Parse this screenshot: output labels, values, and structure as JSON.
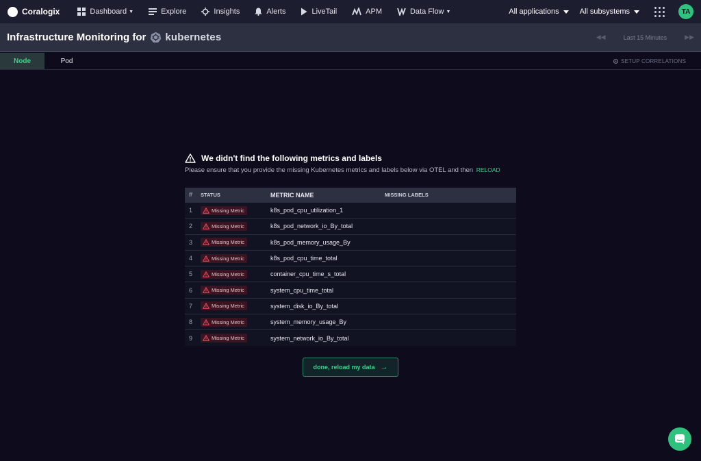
{
  "topnav": {
    "brand": "Coralogix",
    "items": [
      {
        "label": "Dashboard",
        "icon": "dashboard-icon",
        "caret": true
      },
      {
        "label": "Explore",
        "icon": "explore-icon",
        "caret": false
      },
      {
        "label": "Insights",
        "icon": "insights-icon",
        "caret": false
      },
      {
        "label": "Alerts",
        "icon": "bell-icon",
        "caret": false
      },
      {
        "label": "LiveTail",
        "icon": "play-icon",
        "caret": false
      },
      {
        "label": "APM",
        "icon": "apm-icon",
        "caret": false
      },
      {
        "label": "Data Flow",
        "icon": "dataflow-icon",
        "caret": true
      }
    ],
    "applications": "All applications",
    "subsystems": "All subsystems",
    "avatar": "TA"
  },
  "header": {
    "title": "Infrastructure Monitoring for",
    "platform": "kubernetes",
    "time_range": "Last 15 Minutes"
  },
  "tabs": [
    {
      "label": "Node",
      "active": true
    },
    {
      "label": "Pod",
      "active": false
    }
  ],
  "setup_correlations": "SETUP CORRELATIONS",
  "notice": {
    "title": "We didn't find the following metrics and labels",
    "subtitle": "Please ensure that you provide the missing Kubernetes metrics and labels below via OTEL and then",
    "reload": "RELOAD"
  },
  "table": {
    "headers": {
      "num": "#",
      "status": "STATUS",
      "metric": "METRIC NAME",
      "labels": "MISSING LABELS"
    },
    "rows": [
      {
        "num": "1",
        "status": "Missing Metric",
        "metric": "k8s_pod_cpu_utilization_1",
        "labels": ""
      },
      {
        "num": "2",
        "status": "Missing Metric",
        "metric": "k8s_pod_network_io_By_total",
        "labels": ""
      },
      {
        "num": "3",
        "status": "Missing Metric",
        "metric": "k8s_pod_memory_usage_By",
        "labels": ""
      },
      {
        "num": "4",
        "status": "Missing Metric",
        "metric": "k8s_pod_cpu_time_total",
        "labels": ""
      },
      {
        "num": "5",
        "status": "Missing Metric",
        "metric": "container_cpu_time_s_total",
        "labels": ""
      },
      {
        "num": "6",
        "status": "Missing Metric",
        "metric": "system_cpu_time_total",
        "labels": ""
      },
      {
        "num": "7",
        "status": "Missing Metric",
        "metric": "system_disk_io_By_total",
        "labels": ""
      },
      {
        "num": "8",
        "status": "Missing Metric",
        "metric": "system_memory_usage_By",
        "labels": ""
      },
      {
        "num": "9",
        "status": "Missing Metric",
        "metric": "system_network_io_By_total",
        "labels": ""
      }
    ]
  },
  "done_button": "done, reload my data",
  "colors": {
    "accent": "#3fd08a",
    "background": "#0e0c1c",
    "error": "#e04a5c"
  }
}
